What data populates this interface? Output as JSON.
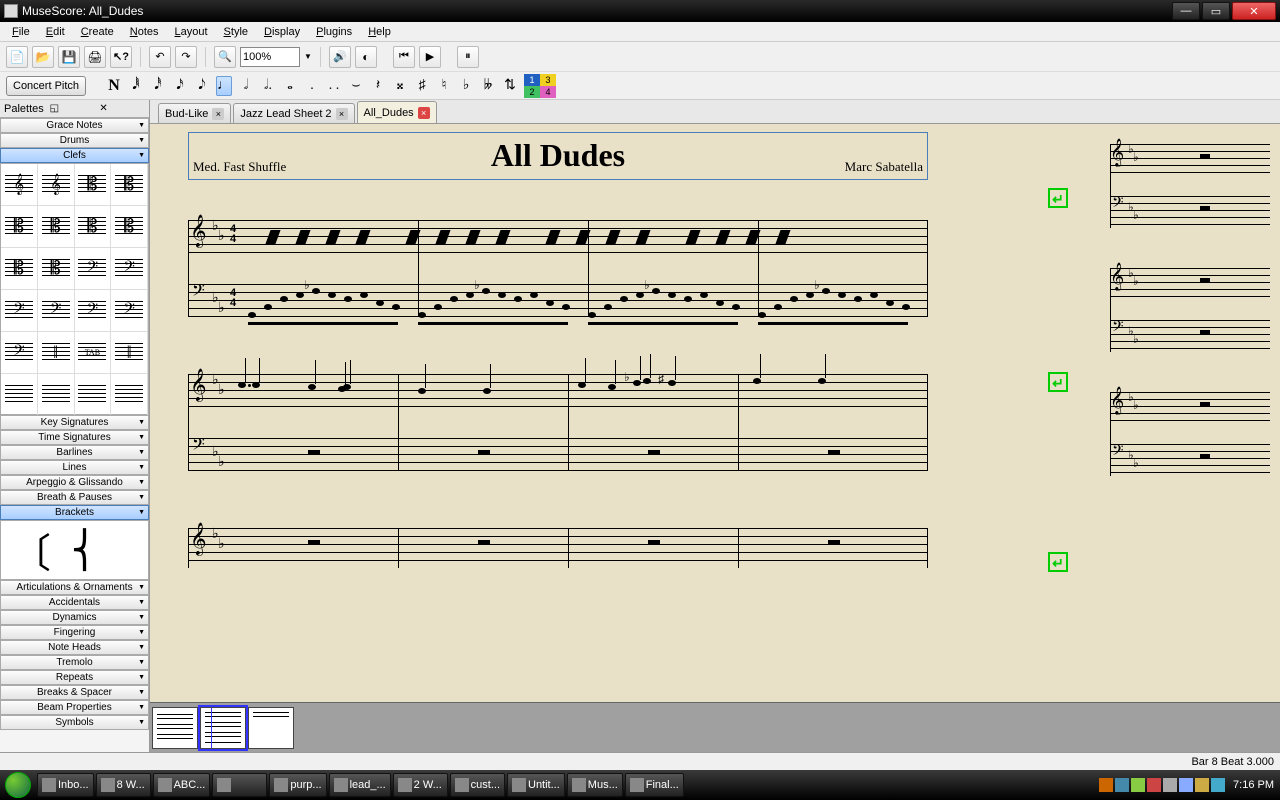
{
  "window": {
    "title": "MuseScore: All_Dudes"
  },
  "menu": [
    "File",
    "Edit",
    "Create",
    "Notes",
    "Layout",
    "Style",
    "Display",
    "Plugins",
    "Help"
  ],
  "toolbar": {
    "zoom": "100%",
    "concert_pitch": "Concert Pitch",
    "note_input_label": "N"
  },
  "voices": [
    {
      "n": "1",
      "bg": "#2060c0"
    },
    {
      "n": "2",
      "bg": "#40c060"
    },
    {
      "n": "3",
      "bg": "#f0d020"
    },
    {
      "n": "4",
      "bg": "#e060c0"
    }
  ],
  "palettes": {
    "title": "Palettes",
    "rows_top": [
      "Grace Notes",
      "Drums",
      "Clefs"
    ],
    "rows_mid": [
      "Key Signatures",
      "Time Signatures",
      "Barlines",
      "Lines",
      "Arpeggio & Glissando",
      "Breath & Pauses",
      "Brackets"
    ],
    "rows_bot": [
      "Articulations & Ornaments",
      "Accidentals",
      "Dynamics",
      "Fingering",
      "Note Heads",
      "Tremolo",
      "Repeats",
      "Breaks & Spacer",
      "Beam Properties",
      "Symbols"
    ],
    "selected_top": "Clefs",
    "selected_mid": "Brackets"
  },
  "tabs": [
    {
      "label": "Bud-Like",
      "active": false
    },
    {
      "label": "Jazz Lead Sheet 2",
      "active": false
    },
    {
      "label": "All_Dudes",
      "active": true
    }
  ],
  "score": {
    "title": "All Dudes",
    "tempo": "Med. Fast Shuffle",
    "composer": "Marc Sabatella",
    "timesig_top": "4",
    "timesig_bot": "4"
  },
  "status": {
    "right": "Bar   8 Beat   3.000"
  },
  "taskbar": {
    "items": [
      "Inbo...",
      "8 W...",
      "ABC...",
      "",
      "purp...",
      "lead_...",
      "2 W...",
      "cust...",
      "Untit...",
      "Mus...",
      "Final..."
    ],
    "time": "7:16 PM"
  }
}
